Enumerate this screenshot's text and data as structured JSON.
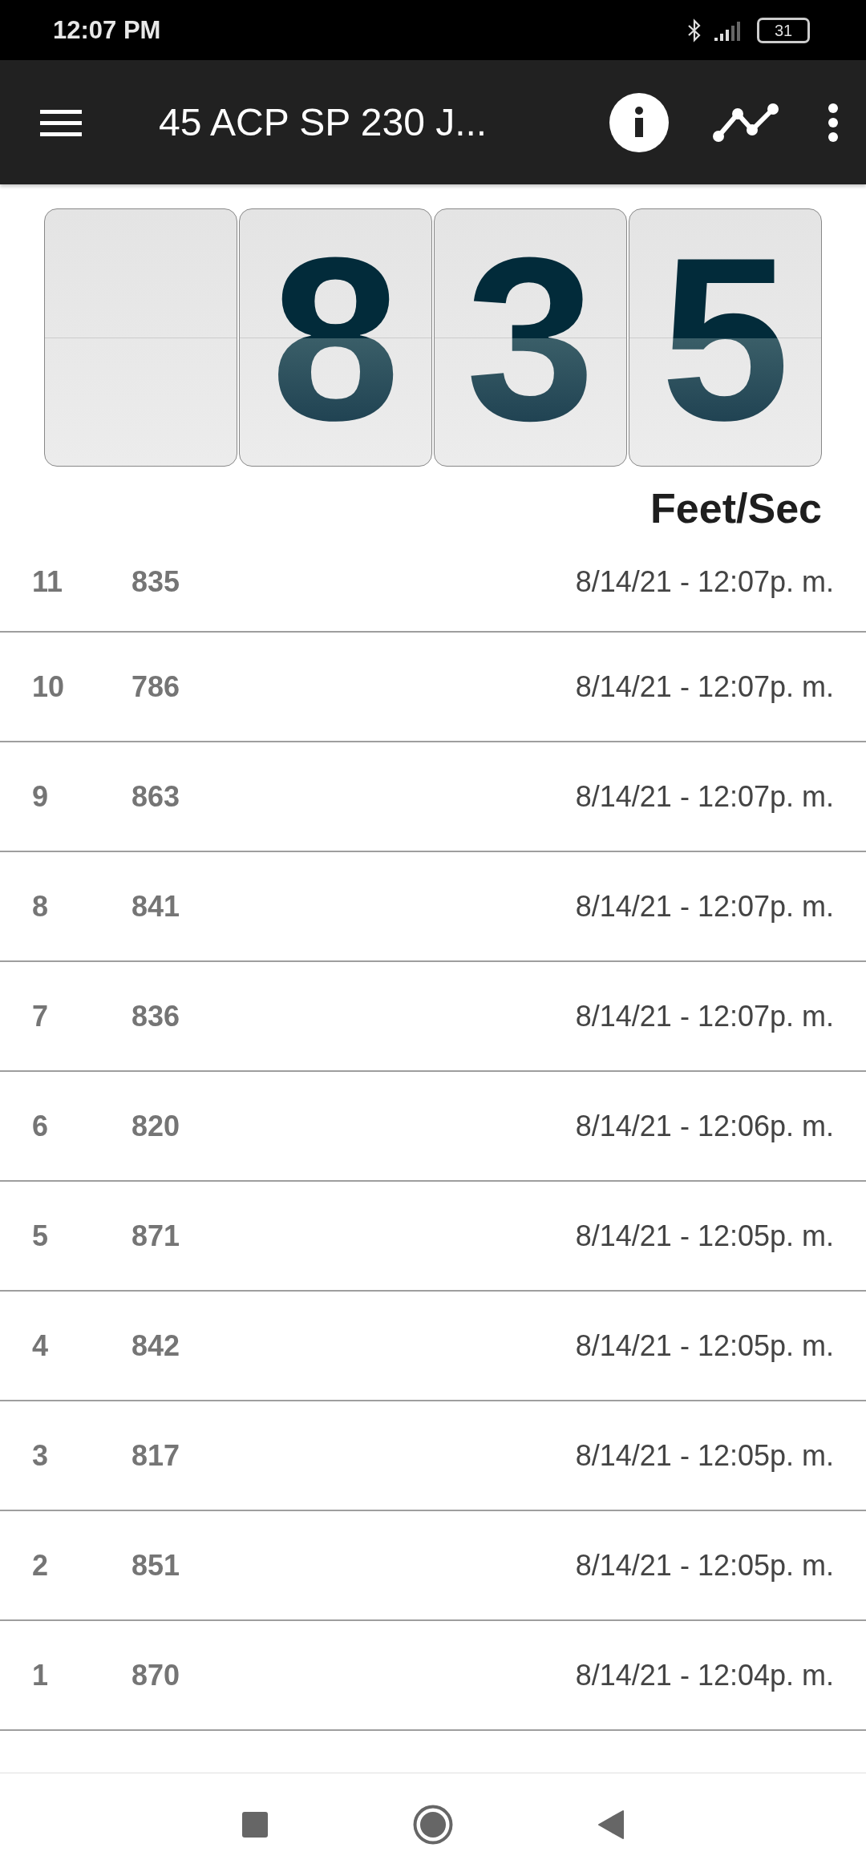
{
  "status_bar": {
    "time": "12:07 PM",
    "battery": "31"
  },
  "toolbar": {
    "title": "45 ACP SP 230 J..."
  },
  "display": {
    "digits": [
      {
        "kind": "blank"
      },
      {
        "kind": "digit",
        "value": "8"
      },
      {
        "kind": "digit",
        "value": "3"
      },
      {
        "kind": "digit",
        "value": "5"
      }
    ],
    "unit": "Feet/Sec"
  },
  "readings": [
    {
      "index": "11",
      "value": "835",
      "time": "8/14/21 - 12:07p. m."
    },
    {
      "index": "10",
      "value": "786",
      "time": "8/14/21 - 12:07p. m."
    },
    {
      "index": "9",
      "value": "863",
      "time": "8/14/21 - 12:07p. m."
    },
    {
      "index": "8",
      "value": "841",
      "time": "8/14/21 - 12:07p. m."
    },
    {
      "index": "7",
      "value": "836",
      "time": "8/14/21 - 12:07p. m."
    },
    {
      "index": "6",
      "value": "820",
      "time": "8/14/21 - 12:06p. m."
    },
    {
      "index": "5",
      "value": "871",
      "time": "8/14/21 - 12:05p. m."
    },
    {
      "index": "4",
      "value": "842",
      "time": "8/14/21 - 12:05p. m."
    },
    {
      "index": "3",
      "value": "817",
      "time": "8/14/21 - 12:05p. m."
    },
    {
      "index": "2",
      "value": "851",
      "time": "8/14/21 - 12:05p. m."
    },
    {
      "index": "1",
      "value": "870",
      "time": "8/14/21 - 12:04p. m."
    }
  ]
}
